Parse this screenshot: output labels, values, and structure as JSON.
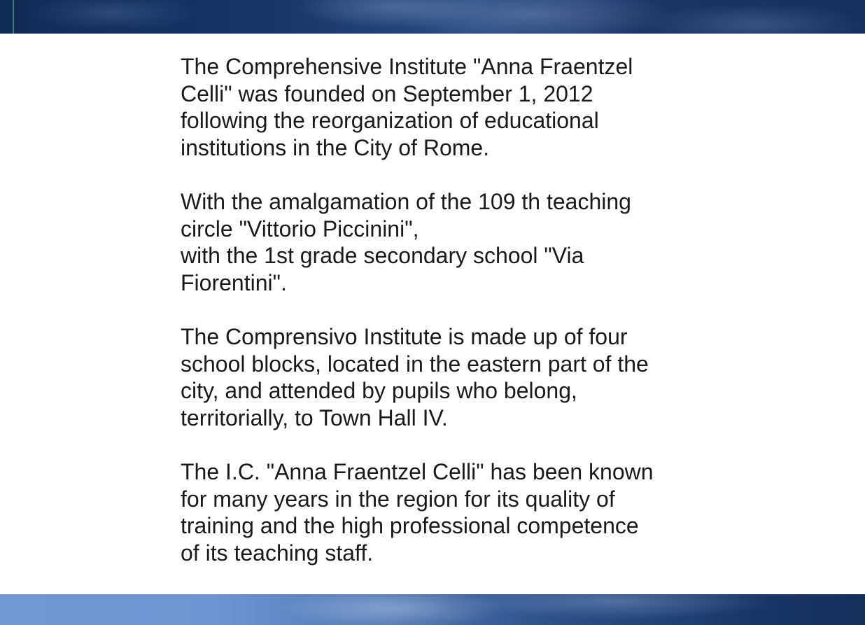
{
  "paragraphs": [
    "The Comprehensive Institute \"Anna Fraentzel\nCelli\" was founded on September 1, 2012\nfollowing the reorganization of educational\ninstitutions in the City of Rome.",
    "With the amalgamation of the 109 th teaching\ncircle \"Vittorio Piccinini\",\nwith the 1st grade secondary school \"Via\nFiorentini\".",
    "The Comprensivo Institute is made up of four\nschool blocks, located in the eastern part of the\ncity, and attended by pupils who belong,\nterritorially, to Town Hall IV.",
    "The I.C. \"Anna Fraentzel Celli\" has been known\nfor many years in the region for its quality of\ntraining and the high professional competence\nof its teaching staff."
  ]
}
